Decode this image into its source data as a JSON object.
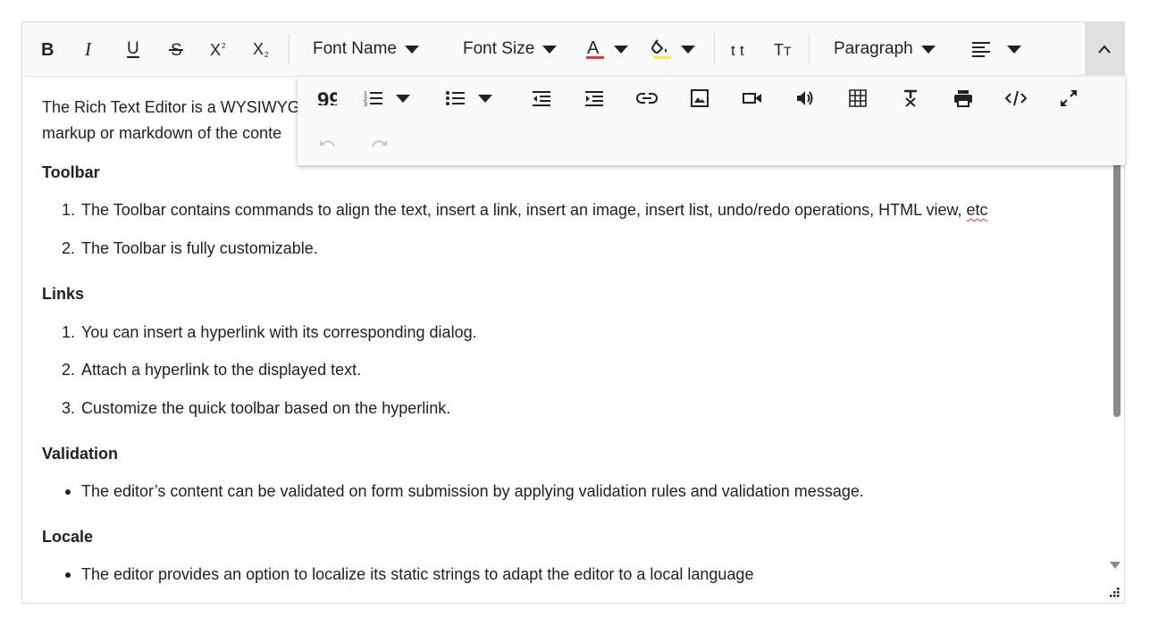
{
  "toolbar": {
    "font_name": "Font Name",
    "font_size": "Font Size",
    "format": "Paragraph",
    "font_color": "#e53935",
    "background_color": "#ffeb3b"
  },
  "content": {
    "intro_line1": "The Rich Text Editor is a WYSIWYG",
    "intro_line2": "markup or markdown of the conte",
    "sections": [
      {
        "heading": "Toolbar",
        "items": [
          "The Toolbar contains commands to align the text, insert a link, insert an image, insert list, undo/redo operations, HTML view, ",
          "The Toolbar is fully customizable."
        ],
        "items_suffix": "etc"
      },
      {
        "heading": "Links",
        "items": [
          "You can insert a hyperlink with its corresponding dialog.",
          "Attach a hyperlink to the displayed text.",
          "Customize the quick toolbar based on the hyperlink."
        ]
      },
      {
        "heading": "Validation",
        "items": [
          "The editor’s content can be validated on form submission by applying validation rules and validation message."
        ]
      },
      {
        "heading": "Locale",
        "items": [
          "The editor provides an option to localize its static strings to adapt the editor to a local language"
        ]
      }
    ],
    "numbers": [
      "1.",
      "2.",
      "3."
    ]
  }
}
